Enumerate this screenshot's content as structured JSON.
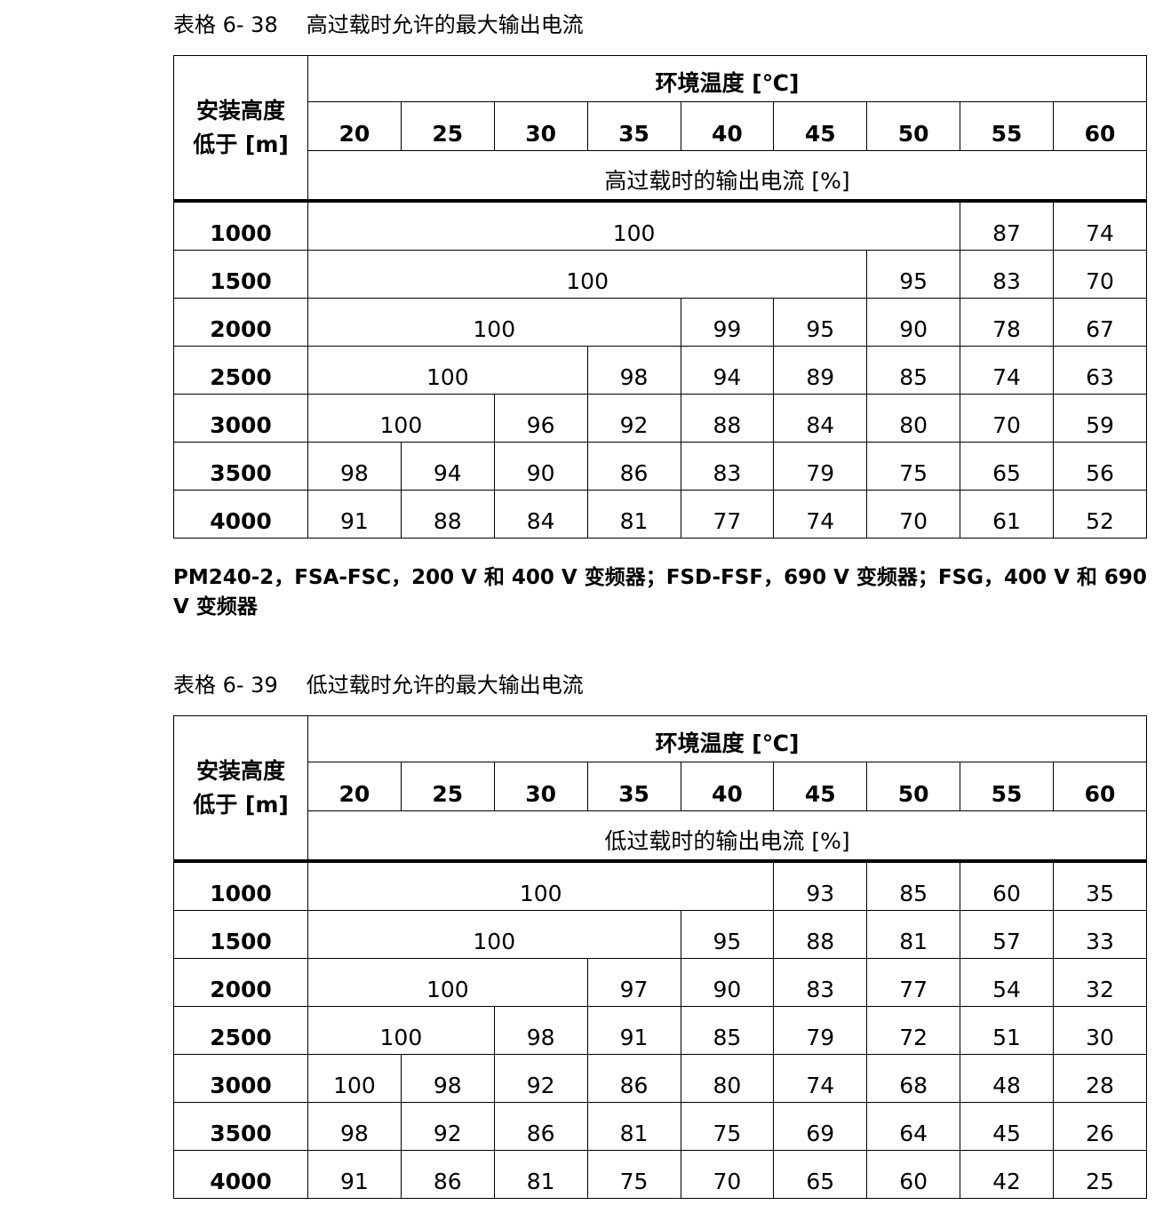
{
  "tables": [
    {
      "caption_number": "表格 6- 38",
      "caption_title": "高过载时允许的最大输出电流",
      "altitude_header_line1": "安装高度",
      "altitude_header_line2": "低于 [m]",
      "temperature_header": "环境温度 [℃]",
      "temperatures": [
        "20",
        "25",
        "30",
        "35",
        "40",
        "45",
        "50",
        "55",
        "60"
      ],
      "current_header": "高过载时的输出电流 [%]",
      "rows": [
        {
          "altitude": "1000",
          "cells": [
            {
              "value": "100",
              "span": 7
            },
            {
              "value": "87",
              "span": 1
            },
            {
              "value": "74",
              "span": 1
            }
          ]
        },
        {
          "altitude": "1500",
          "cells": [
            {
              "value": "100",
              "span": 6
            },
            {
              "value": "95",
              "span": 1
            },
            {
              "value": "83",
              "span": 1
            },
            {
              "value": "70",
              "span": 1
            }
          ]
        },
        {
          "altitude": "2000",
          "cells": [
            {
              "value": "100",
              "span": 4
            },
            {
              "value": "99",
              "span": 1
            },
            {
              "value": "95",
              "span": 1
            },
            {
              "value": "90",
              "span": 1
            },
            {
              "value": "78",
              "span": 1
            },
            {
              "value": "67",
              "span": 1
            }
          ]
        },
        {
          "altitude": "2500",
          "cells": [
            {
              "value": "100",
              "span": 3
            },
            {
              "value": "98",
              "span": 1
            },
            {
              "value": "94",
              "span": 1
            },
            {
              "value": "89",
              "span": 1
            },
            {
              "value": "85",
              "span": 1
            },
            {
              "value": "74",
              "span": 1
            },
            {
              "value": "63",
              "span": 1
            }
          ]
        },
        {
          "altitude": "3000",
          "cells": [
            {
              "value": "100",
              "span": 2
            },
            {
              "value": "96",
              "span": 1
            },
            {
              "value": "92",
              "span": 1
            },
            {
              "value": "88",
              "span": 1
            },
            {
              "value": "84",
              "span": 1
            },
            {
              "value": "80",
              "span": 1
            },
            {
              "value": "70",
              "span": 1
            },
            {
              "value": "59",
              "span": 1
            }
          ]
        },
        {
          "altitude": "3500",
          "cells": [
            {
              "value": "98",
              "span": 1
            },
            {
              "value": "94",
              "span": 1
            },
            {
              "value": "90",
              "span": 1
            },
            {
              "value": "86",
              "span": 1
            },
            {
              "value": "83",
              "span": 1
            },
            {
              "value": "79",
              "span": 1
            },
            {
              "value": "75",
              "span": 1
            },
            {
              "value": "65",
              "span": 1
            },
            {
              "value": "56",
              "span": 1
            }
          ]
        },
        {
          "altitude": "4000",
          "cells": [
            {
              "value": "91",
              "span": 1
            },
            {
              "value": "88",
              "span": 1
            },
            {
              "value": "84",
              "span": 1
            },
            {
              "value": "81",
              "span": 1
            },
            {
              "value": "77",
              "span": 1
            },
            {
              "value": "74",
              "span": 1
            },
            {
              "value": "70",
              "span": 1
            },
            {
              "value": "61",
              "span": 1
            },
            {
              "value": "52",
              "span": 1
            }
          ]
        }
      ]
    },
    {
      "caption_number": "表格 6- 39",
      "caption_title": "低过载时允许的最大输出电流",
      "altitude_header_line1": "安装高度",
      "altitude_header_line2": "低于 [m]",
      "temperature_header": "环境温度 [℃]",
      "temperatures": [
        "20",
        "25",
        "30",
        "35",
        "40",
        "45",
        "50",
        "55",
        "60"
      ],
      "current_header": "低过载时的输出电流 [%]",
      "rows": [
        {
          "altitude": "1000",
          "cells": [
            {
              "value": "100",
              "span": 5
            },
            {
              "value": "93",
              "span": 1
            },
            {
              "value": "85",
              "span": 1
            },
            {
              "value": "60",
              "span": 1
            },
            {
              "value": "35",
              "span": 1
            }
          ]
        },
        {
          "altitude": "1500",
          "cells": [
            {
              "value": "100",
              "span": 4
            },
            {
              "value": "95",
              "span": 1
            },
            {
              "value": "88",
              "span": 1
            },
            {
              "value": "81",
              "span": 1
            },
            {
              "value": "57",
              "span": 1
            },
            {
              "value": "33",
              "span": 1
            }
          ]
        },
        {
          "altitude": "2000",
          "cells": [
            {
              "value": "100",
              "span": 3
            },
            {
              "value": "97",
              "span": 1
            },
            {
              "value": "90",
              "span": 1
            },
            {
              "value": "83",
              "span": 1
            },
            {
              "value": "77",
              "span": 1
            },
            {
              "value": "54",
              "span": 1
            },
            {
              "value": "32",
              "span": 1
            }
          ]
        },
        {
          "altitude": "2500",
          "cells": [
            {
              "value": "100",
              "span": 2
            },
            {
              "value": "98",
              "span": 1
            },
            {
              "value": "91",
              "span": 1
            },
            {
              "value": "85",
              "span": 1
            },
            {
              "value": "79",
              "span": 1
            },
            {
              "value": "72",
              "span": 1
            },
            {
              "value": "51",
              "span": 1
            },
            {
              "value": "30",
              "span": 1
            }
          ]
        },
        {
          "altitude": "3000",
          "cells": [
            {
              "value": "100",
              "span": 1
            },
            {
              "value": "98",
              "span": 1
            },
            {
              "value": "92",
              "span": 1
            },
            {
              "value": "86",
              "span": 1
            },
            {
              "value": "80",
              "span": 1
            },
            {
              "value": "74",
              "span": 1
            },
            {
              "value": "68",
              "span": 1
            },
            {
              "value": "48",
              "span": 1
            },
            {
              "value": "28",
              "span": 1
            }
          ]
        },
        {
          "altitude": "3500",
          "cells": [
            {
              "value": "98",
              "span": 1
            },
            {
              "value": "92",
              "span": 1
            },
            {
              "value": "86",
              "span": 1
            },
            {
              "value": "81",
              "span": 1
            },
            {
              "value": "75",
              "span": 1
            },
            {
              "value": "69",
              "span": 1
            },
            {
              "value": "64",
              "span": 1
            },
            {
              "value": "45",
              "span": 1
            },
            {
              "value": "26",
              "span": 1
            }
          ]
        },
        {
          "altitude": "4000",
          "cells": [
            {
              "value": "91",
              "span": 1
            },
            {
              "value": "86",
              "span": 1
            },
            {
              "value": "81",
              "span": 1
            },
            {
              "value": "75",
              "span": 1
            },
            {
              "value": "70",
              "span": 1
            },
            {
              "value": "65",
              "span": 1
            },
            {
              "value": "60",
              "span": 1
            },
            {
              "value": "42",
              "span": 1
            },
            {
              "value": "25",
              "span": 1
            }
          ]
        }
      ]
    }
  ],
  "note": "PM240-2，FSA-FSC，200 V 和 400 V 变频器；FSD-FSF，690 V 变频器；FSG，400 V 和 690 V 变频器"
}
